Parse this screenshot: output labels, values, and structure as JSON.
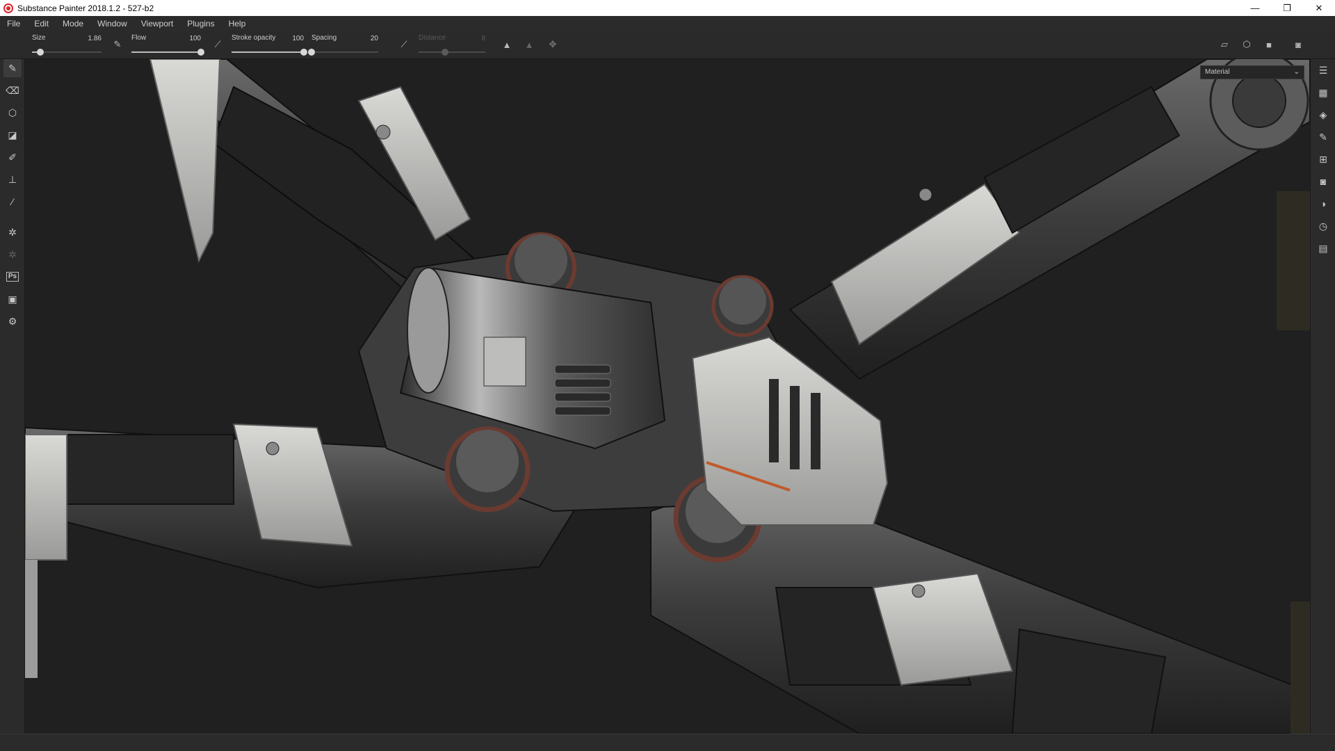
{
  "titlebar": {
    "title": "Substance Painter 2018.1.2 - 527-b2",
    "minimize": "—",
    "restore": "❐",
    "close": "✕"
  },
  "menu": [
    "File",
    "Edit",
    "Mode",
    "Window",
    "Viewport",
    "Plugins",
    "Help"
  ],
  "toolbar": {
    "size": {
      "label": "Size",
      "value": "1.86",
      "level": 0.12
    },
    "flow": {
      "label": "Flow",
      "value": "100",
      "level": 1.0
    },
    "stroke_opacity": {
      "label": "Stroke opacity",
      "value": "100",
      "level": 1.0
    },
    "spacing": {
      "label": "Spacing",
      "value": "20",
      "level": 0.0
    },
    "distance": {
      "label": "Distance",
      "value": "8",
      "level": 0.4
    }
  },
  "viewport": {
    "channel_select": "Material"
  },
  "icons": {
    "lazy_mouse": "⟋",
    "symmetry": "▲",
    "symmetry_dim": "▲",
    "transform": "✥",
    "view_2d": "▱",
    "view_3d": "⬡",
    "camera": "■",
    "screenshot": "◙"
  },
  "left_tools": [
    "paint-brush-icon",
    "eraser-icon",
    "projection-icon",
    "geometry-fill-icon",
    "smudge-icon",
    "clone-stamp-icon",
    "color-picker-icon",
    "bake-icon",
    "iray-icon",
    "photoshop-icon",
    "export-icon",
    "settings-icon"
  ],
  "right_tools": [
    "layers-icon",
    "texture-set-icon",
    "layer-stack-icon",
    "properties-icon",
    "display-settings-icon",
    "viewer-settings-icon",
    "shader-settings-icon",
    "history-icon",
    "log-icon"
  ]
}
